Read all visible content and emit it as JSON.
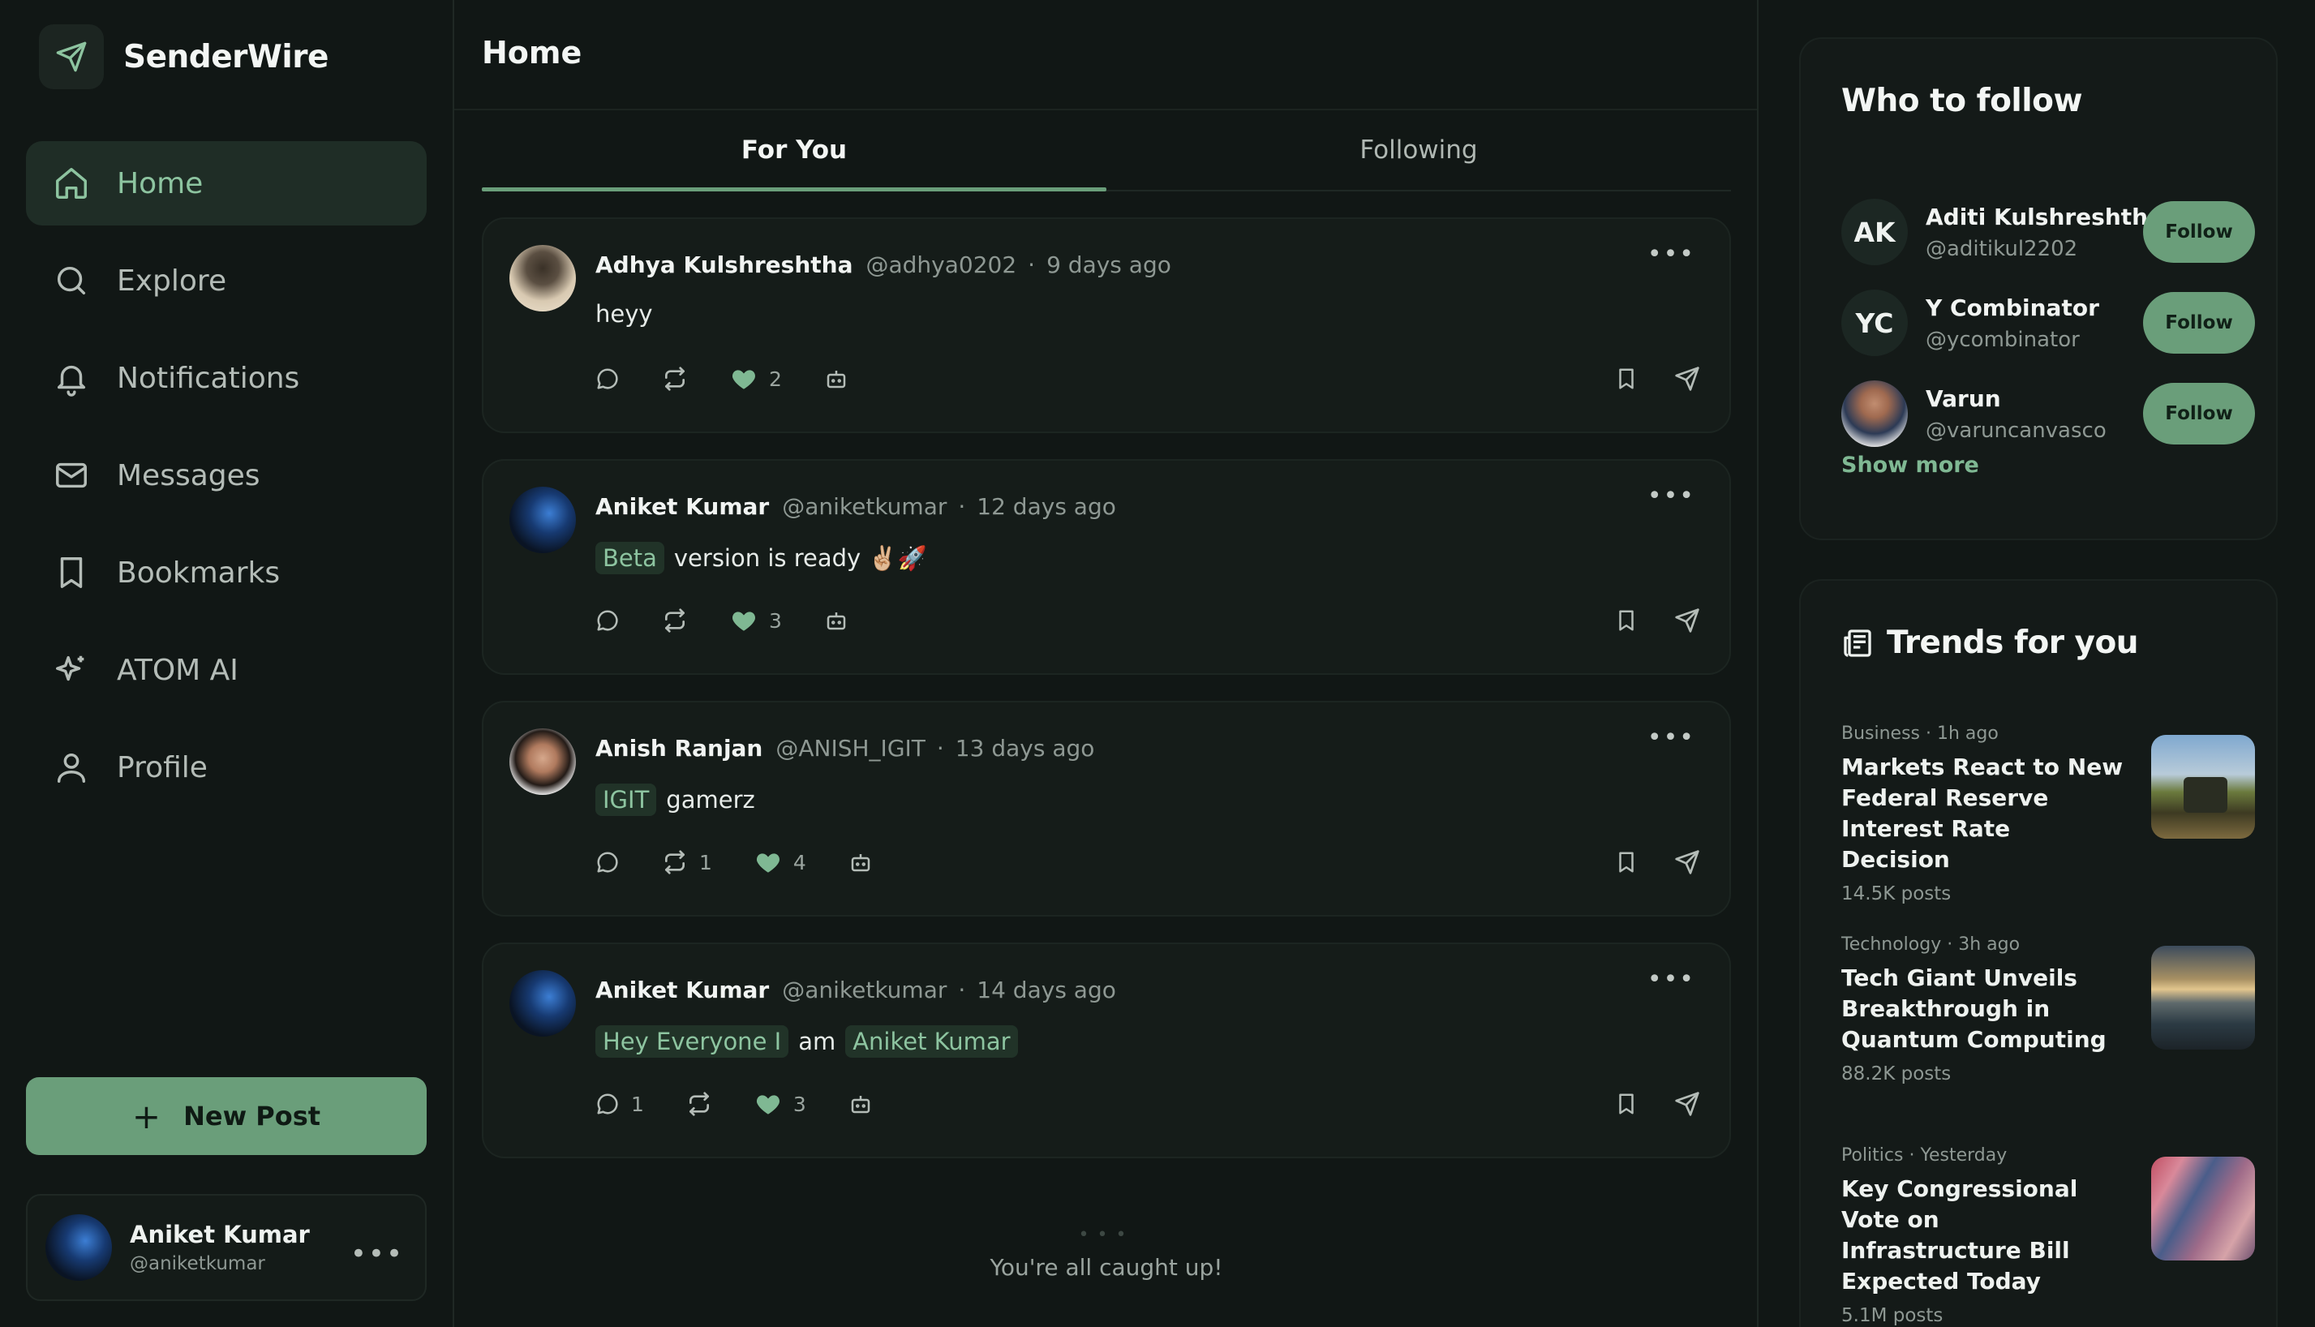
{
  "app": {
    "name": "SenderWire"
  },
  "sidebar": {
    "nav": [
      {
        "label": "Home",
        "icon": "home-icon",
        "active": true
      },
      {
        "label": "Explore",
        "icon": "search-icon"
      },
      {
        "label": "Notifications",
        "icon": "bell-icon"
      },
      {
        "label": "Messages",
        "icon": "mail-icon"
      },
      {
        "label": "Bookmarks",
        "icon": "bookmark-icon"
      },
      {
        "label": "ATOM AI",
        "icon": "sparkles-icon"
      },
      {
        "label": "Profile",
        "icon": "user-icon"
      }
    ],
    "new_post_label": "New Post",
    "account": {
      "name": "Aniket Kumar",
      "handle": "@aniketkumar"
    }
  },
  "feed": {
    "title": "Home",
    "tabs": [
      {
        "label": "For You",
        "active": true
      },
      {
        "label": "Following",
        "active": false
      }
    ],
    "posts": [
      {
        "name": "Adhya Kulshreshtha",
        "handle": "@adhya0202",
        "time": "9 days ago",
        "text": "heyy",
        "comments": "",
        "reposts": "",
        "likes": "2"
      },
      {
        "name": "Aniket Kumar",
        "handle": "@aniketkumar",
        "time": "12 days ago",
        "tag": "Beta",
        "text": "version is ready ✌🏼🚀",
        "comments": "",
        "reposts": "",
        "likes": "3"
      },
      {
        "name": "Anish Ranjan",
        "handle": "@ANISH_IGIT",
        "time": "13 days ago",
        "tag": "IGIT",
        "text": "gamerz",
        "comments": "",
        "reposts": "1",
        "likes": "4"
      },
      {
        "name": "Aniket Kumar",
        "handle": "@aniketkumar",
        "time": "14 days ago",
        "tag": "Hey Everyone I",
        "text": "am",
        "tag2": "Aniket Kumar",
        "comments": "1",
        "reposts": "",
        "likes": "3"
      }
    ],
    "end_message": "You're all caught up!"
  },
  "who_to_follow": {
    "title": "Who to follow",
    "users": [
      {
        "initials": "AK",
        "name": "Aditi Kulshreshtha",
        "handle": "@aditikul2202",
        "button": "Follow"
      },
      {
        "initials": "YC",
        "name": "Y Combinator",
        "handle": "@ycombinator",
        "button": "Follow"
      },
      {
        "initials": "",
        "name": "Varun",
        "handle": "@varuncanvasco",
        "button": "Follow"
      }
    ],
    "show_more": "Show more"
  },
  "trends": {
    "title": "Trends for you",
    "items": [
      {
        "meta": "Business · 1h ago",
        "title": "Markets React to New Federal Reserve Interest Rate Decision",
        "posts": "14.5K posts"
      },
      {
        "meta": "Technology · 3h ago",
        "title": "Tech Giant Unveils Breakthrough in Quantum Computing",
        "posts": "88.2K posts"
      },
      {
        "meta": "Politics · Yesterday",
        "title": "Key Congressional Vote on Infrastructure Bill Expected Today",
        "posts": "5.1M posts"
      }
    ]
  },
  "colors": {
    "background": "#111715",
    "accent": "#6a9e7a",
    "accent_text": "#8dc4a0",
    "card": "#151c19"
  }
}
